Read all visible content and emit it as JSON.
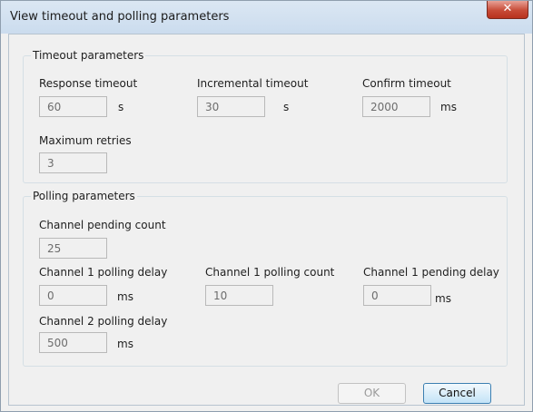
{
  "window": {
    "title": "View timeout and polling parameters",
    "close_glyph": "✕"
  },
  "timeout_group": {
    "title": "Timeout parameters",
    "response_timeout": {
      "label": "Response timeout",
      "value": "60",
      "unit": "s"
    },
    "incremental_timeout": {
      "label": "Incremental timeout",
      "value": "30",
      "unit": "s"
    },
    "confirm_timeout": {
      "label": "Confirm timeout",
      "value": "2000",
      "unit": "ms"
    },
    "maximum_retries": {
      "label": "Maximum retries",
      "value": "3"
    }
  },
  "polling_group": {
    "title": "Polling parameters",
    "channel_pending_count": {
      "label": "Channel pending count",
      "value": "25"
    },
    "channel1_polling_delay": {
      "label": "Channel 1 polling delay",
      "value": "0",
      "unit": "ms"
    },
    "channel1_polling_count": {
      "label": "Channel 1 polling count",
      "value": "10"
    },
    "channel1_pending_delay": {
      "label": "Channel 1 pending delay",
      "value": "0",
      "unit": "ms"
    },
    "channel2_polling_delay": {
      "label": "Channel 2 polling delay",
      "value": "500",
      "unit": "ms"
    }
  },
  "buttons": {
    "ok": "OK",
    "cancel": "Cancel"
  }
}
